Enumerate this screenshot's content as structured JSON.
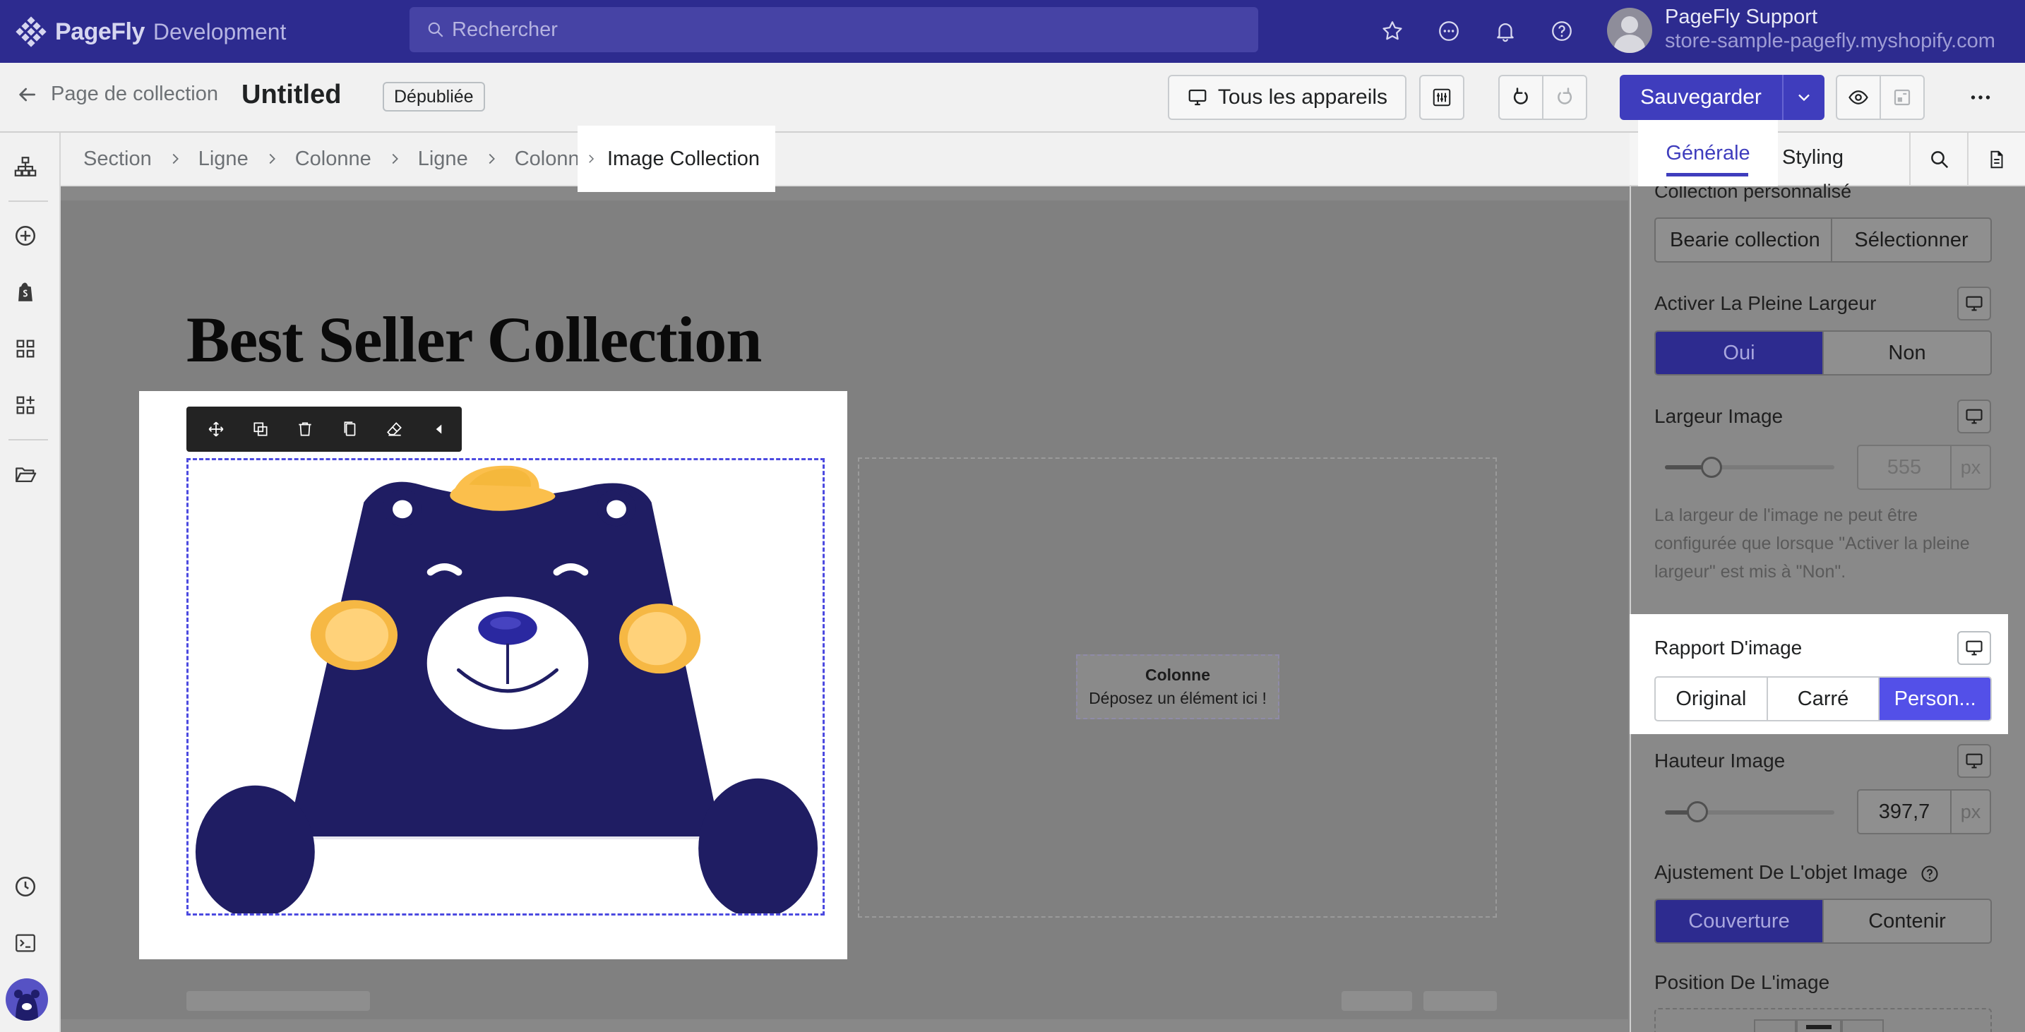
{
  "topbar": {
    "brand": "PageFly",
    "env": "Development",
    "search_placeholder": "Rechercher",
    "user_name": "PageFly Support",
    "user_store": "store-sample-pagefly.myshopify.com"
  },
  "toolbar": {
    "back_label": "Page de collection",
    "page_title": "Untitled",
    "status_badge": "Dépubliée",
    "devices_label": "Tous les appareils",
    "save_label": "Sauvegarder"
  },
  "breadcrumb": {
    "items": [
      "Section",
      "Ligne",
      "Colonne",
      "Ligne",
      "Colonne"
    ],
    "active": "Image Collection"
  },
  "canvas": {
    "heading": "Best Seller Collection",
    "column_title": "Colonne",
    "column_hint": "Déposez un élément ici !",
    "toolbar_icons": [
      "move-icon",
      "duplicate-icon",
      "delete-icon",
      "copy-icon",
      "eraser-icon",
      "collapse-icon"
    ]
  },
  "panel": {
    "tabs": {
      "general": "Générale",
      "styling": "Styling"
    },
    "collection_label": "Collection personnalisé",
    "collection_value": "Bearie collection",
    "select_button": "Sélectionner",
    "full_width_label": "Activer La Pleine Largeur",
    "full_width_options": [
      "Oui",
      "Non"
    ],
    "full_width_selected": "Oui",
    "image_width_label": "Largeur Image",
    "image_width_value": "555",
    "image_width_unit": "px",
    "image_width_note": "La largeur de l'image ne peut être configurée que lorsque \"Activer la pleine largeur\" est mis à \"Non\".",
    "ratio_label": "Rapport D'image",
    "ratio_options": [
      "Original",
      "Carré",
      "Person..."
    ],
    "ratio_selected": "Person...",
    "image_height_label": "Hauteur Image",
    "image_height_value": "397,7",
    "image_height_unit": "px",
    "fit_label": "Ajustement De L'objet Image",
    "fit_options": [
      "Couverture",
      "Contenir"
    ],
    "fit_selected": "Couverture",
    "position_label": "Position De L'image"
  },
  "colors": {
    "brand": "#2d2b8f",
    "accent": "#3f3dbd",
    "selected": "#5350e8"
  }
}
